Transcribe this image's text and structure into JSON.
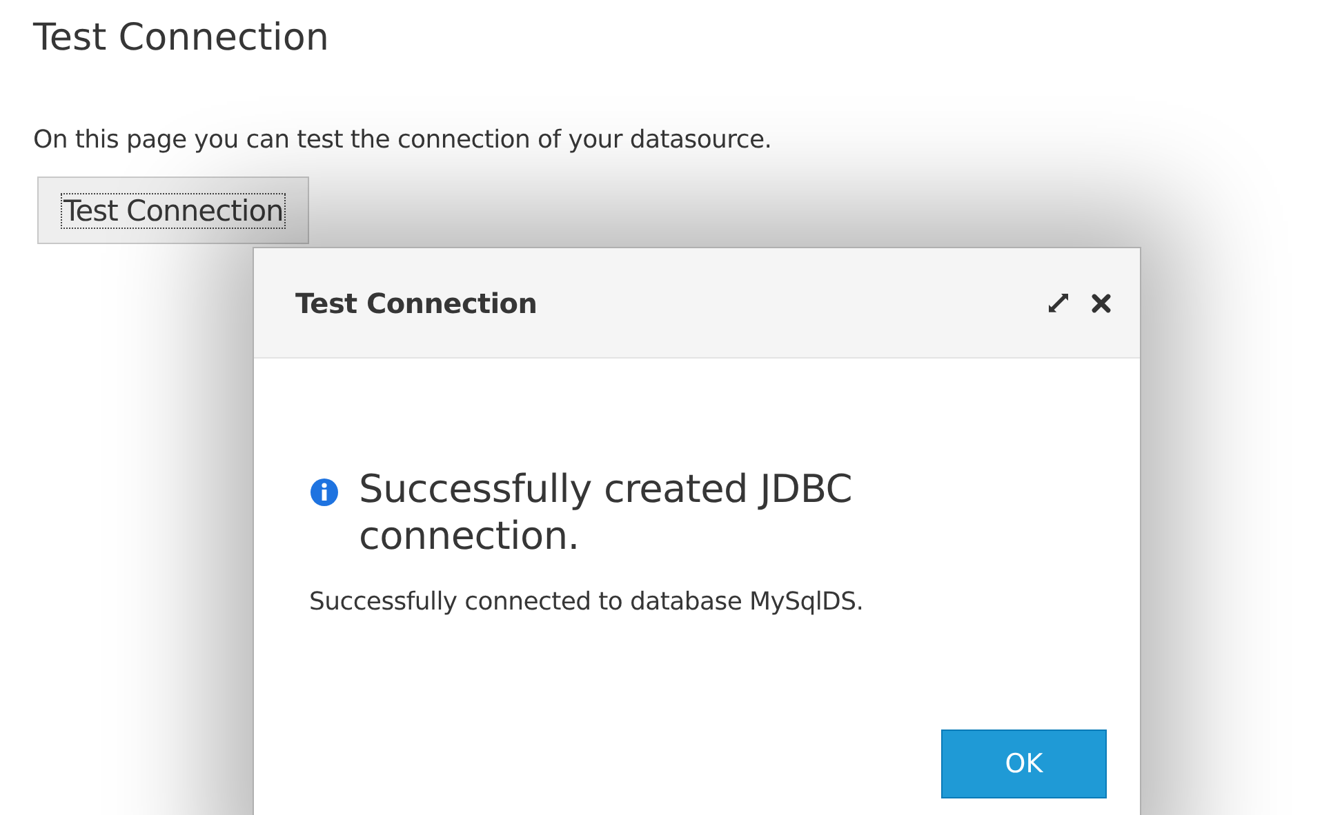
{
  "page": {
    "title": "Test Connection",
    "description": "On this page you can test the connection of your datasource.",
    "button": {
      "label": "Test Connection",
      "focused": true
    }
  },
  "dialog": {
    "title": "Test Connection",
    "message_title": "Successfully created JDBC connection.",
    "message": "Successfully connected to database MySqlDS.",
    "buttons": [
      {
        "label": "OK",
        "kind": "primary"
      }
    ]
  }
}
